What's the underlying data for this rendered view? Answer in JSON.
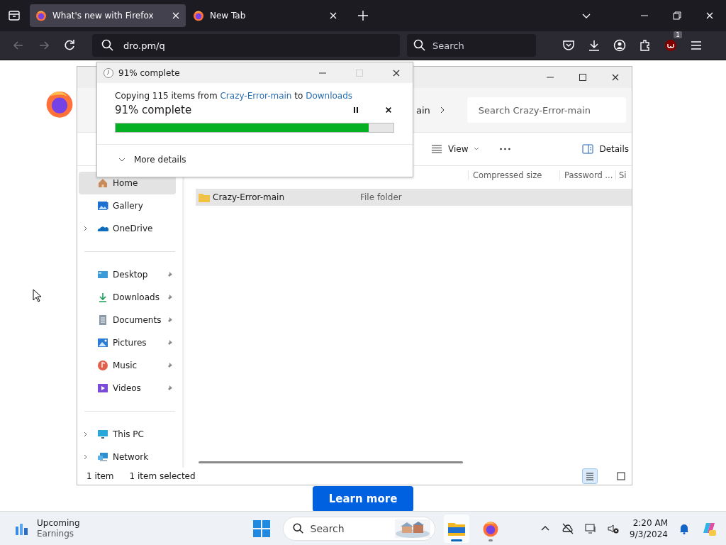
{
  "browser": {
    "tabs": [
      {
        "title": "What's new with Firefox",
        "selected": true
      },
      {
        "title": "New Tab",
        "selected": false
      }
    ],
    "address": "dro.pm/q",
    "search_placeholder": "Search",
    "extension_badge": "1",
    "page_button": "Learn more"
  },
  "explorer": {
    "breadcrumb": "ain",
    "search_placeholder": "Search Crazy-Error-main",
    "view": "View",
    "details": "Details",
    "columns": [
      "Compressed size",
      "Password ...",
      "Si"
    ],
    "rows": [
      {
        "name": "Crazy-Error-main",
        "type": "File folder",
        "selected": true
      }
    ],
    "sidebar": [
      [
        {
          "label": "Home",
          "kind": "home",
          "selected": true,
          "expandable": false,
          "pinned": false
        },
        {
          "label": "Gallery",
          "kind": "gallery",
          "selected": false,
          "expandable": false,
          "pinned": false
        },
        {
          "label": "OneDrive",
          "kind": "cloud",
          "selected": false,
          "expandable": true,
          "pinned": false
        }
      ],
      [
        {
          "label": "Desktop",
          "kind": "desktop",
          "selected": false,
          "expandable": false,
          "pinned": true
        },
        {
          "label": "Downloads",
          "kind": "download",
          "selected": false,
          "expandable": false,
          "pinned": true
        },
        {
          "label": "Documents",
          "kind": "document",
          "selected": false,
          "expandable": false,
          "pinned": true
        },
        {
          "label": "Pictures",
          "kind": "pictures",
          "selected": false,
          "expandable": false,
          "pinned": true
        },
        {
          "label": "Music",
          "kind": "music",
          "selected": false,
          "expandable": false,
          "pinned": true
        },
        {
          "label": "Videos",
          "kind": "videos",
          "selected": false,
          "expandable": false,
          "pinned": true
        }
      ],
      [
        {
          "label": "This PC",
          "kind": "pc",
          "selected": false,
          "expandable": true,
          "pinned": false
        },
        {
          "label": "Network",
          "kind": "network",
          "selected": false,
          "expandable": true,
          "pinned": false
        }
      ]
    ],
    "status": [
      "1 item",
      "1 item selected"
    ]
  },
  "copy_dialog": {
    "title": "91% complete",
    "message_start": "Copying 115 items from",
    "source": "Crazy-Error-main",
    "message_middle": "to",
    "destination": "Downloads",
    "heading": "91% complete",
    "level": 0.91,
    "more": "More details"
  },
  "taskbar": {
    "widget_title": "Upcoming",
    "widget_subtitle": "Earnings",
    "search_placeholder": "Search",
    "time": "2:20 AM",
    "date": "9/3/2024"
  }
}
